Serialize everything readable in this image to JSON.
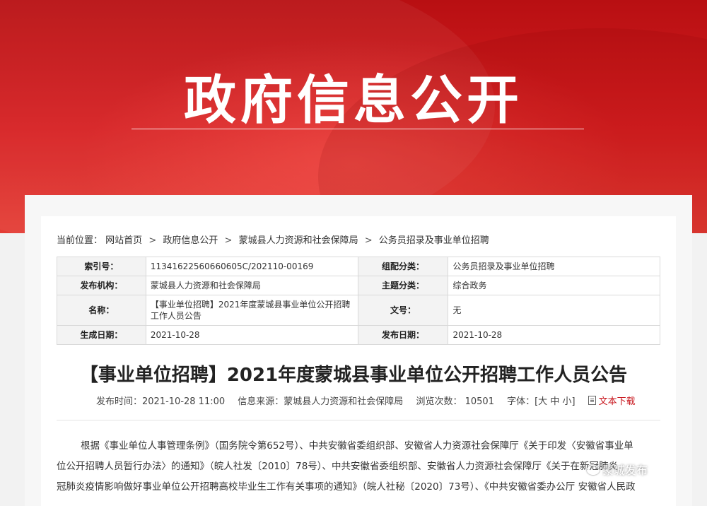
{
  "banner": {
    "title": "政府信息公开"
  },
  "breadcrumb": {
    "prefix": "当前位置：",
    "items": [
      "网站首页",
      "政府信息公开",
      "蒙城县人力资源和社会保障局",
      "公务员招录及事业单位招聘"
    ],
    "separator": ">"
  },
  "meta": {
    "index_label": "索引号：",
    "index_value": "11341622560660605C/202110-00169",
    "category_label": "组配分类：",
    "category_value": "公务员招录及事业单位招聘",
    "publisher_label": "发布机构：",
    "publisher_value": "蒙城县人力资源和社会保障局",
    "topic_label": "主题分类：",
    "topic_value": "综合政务",
    "name_label": "名称：",
    "name_value": "【事业单位招聘】2021年度蒙城县事业单位公开招聘工作人员公告",
    "docno_label": "文号：",
    "docno_value": "无",
    "created_label": "生成日期：",
    "created_value": "2021-10-28",
    "published_label": "发布日期：",
    "published_value": "2021-10-28"
  },
  "article": {
    "title": "【事业单位招聘】2021年度蒙城县事业单位公开招聘工作人员公告",
    "publish_time": "发布时间：2021-10-28 11:00",
    "source": "信息来源：蒙城县人力资源和社会保障局",
    "views_label": "浏览次数：",
    "views_value": "10501",
    "font_label": "字体：[大 中 小]",
    "download_label": "文本下载",
    "paragraph_lines": [
      "根据《事业单位人事管理条例》（国务院令第652号）、中共安徽省委组织部、安徽省人力资源社会保障厅《关于印发〈安徽省事业单",
      "位公开招聘人员暂行办法〉的通知》（皖人社发〔2010〕78号）、中共安徽省委组织部、安徽省人力资源社会保障厅《关于在新冠肺炎",
      "冠肺炎疫情影响做好事业单位公开招聘高校毕业生工作有关事项的通知》（皖人社秘〔2020〕73号）、《中共安徽省委办公厅 安徽省人民政"
    ]
  },
  "watermark": {
    "text": "蒙城发布",
    "icon": "wechat-icon"
  },
  "colors": {
    "banner_red": "#c8161d",
    "link_red": "#c8161d"
  }
}
